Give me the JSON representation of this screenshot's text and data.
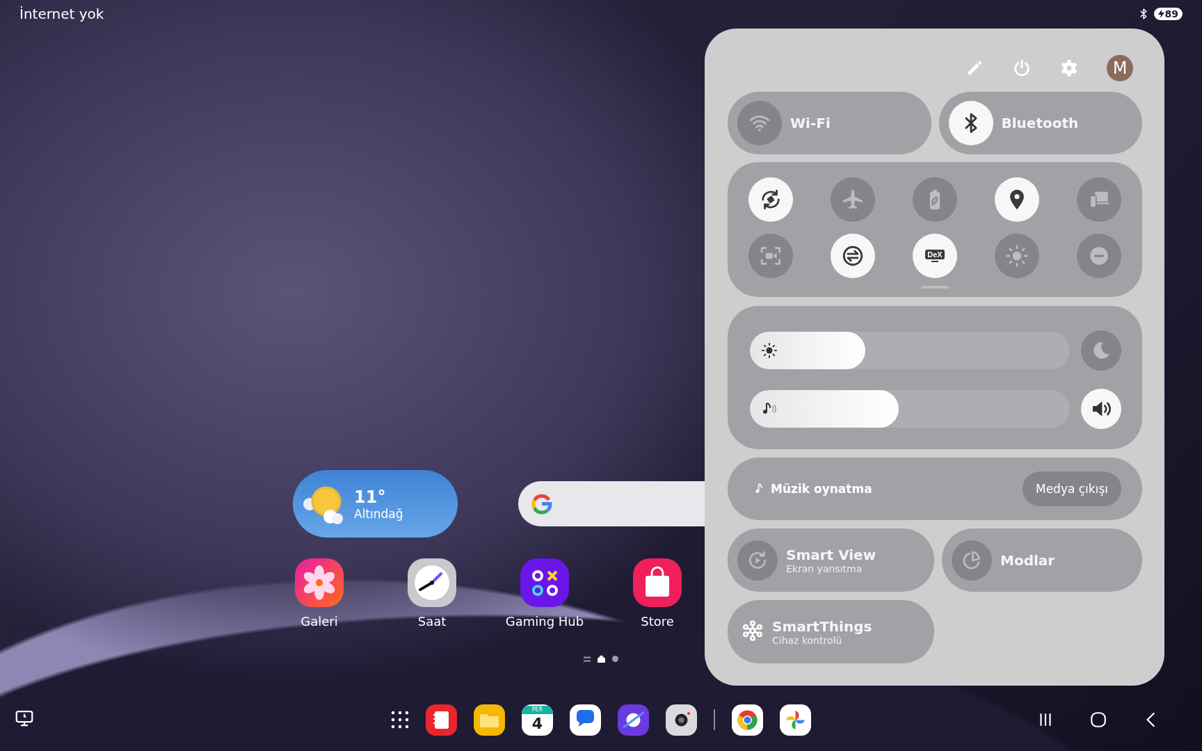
{
  "status_bar": {
    "network_text": "İnternet yok",
    "battery": "89"
  },
  "home": {
    "weather": {
      "temperature": "11°",
      "location": "Altındağ"
    },
    "apps": [
      {
        "label": "Galeri",
        "kind": "flower"
      },
      {
        "label": "Saat",
        "kind": "clock"
      },
      {
        "label": "Gaming Hub",
        "kind": "game"
      },
      {
        "label": "Store",
        "kind": "bag"
      }
    ],
    "page_indicators": [
      {
        "kind": "lines",
        "selected": false
      },
      {
        "kind": "home",
        "selected": true
      },
      {
        "kind": "dot",
        "selected": false
      }
    ]
  },
  "dock": {
    "apps": [
      {
        "kind": "grid"
      },
      {
        "kind": "notebook"
      },
      {
        "kind": "folder"
      },
      {
        "kind": "calendar",
        "month": "PER",
        "day": "4"
      },
      {
        "kind": "chat"
      },
      {
        "kind": "planet"
      },
      {
        "kind": "camera"
      },
      {
        "kind": "divider"
      },
      {
        "kind": "ring"
      },
      {
        "kind": "pinwheel"
      }
    ]
  },
  "quick_panel": {
    "avatar": "M",
    "main_tiles": [
      {
        "label": "Wi-Fi",
        "kind": "wifi",
        "on": false
      },
      {
        "label": "Bluetooth",
        "kind": "bluetooth",
        "on": true
      }
    ],
    "toggles": [
      {
        "kind": "rotate",
        "on": true
      },
      {
        "kind": "airplane",
        "on": false
      },
      {
        "kind": "battery",
        "on": false
      },
      {
        "kind": "location",
        "on": true
      },
      {
        "kind": "devices",
        "on": false
      },
      {
        "kind": "record",
        "on": false
      },
      {
        "kind": "sync",
        "on": true
      },
      {
        "kind": "dex",
        "text": "DeX",
        "on": true
      },
      {
        "kind": "sun",
        "on": false
      },
      {
        "kind": "dnd",
        "on": false
      }
    ],
    "sliders": [
      {
        "kind": "brightness",
        "level": 0.36,
        "button_on": false
      },
      {
        "kind": "volume",
        "level": 0.465,
        "button_on": true
      }
    ],
    "media": {
      "title": "Müzik oynatma",
      "button": "Medya çıkışı"
    },
    "tiles": [
      {
        "label": "Smart View",
        "sublabel": "Ekran yansıtma",
        "kind": "mirror"
      },
      {
        "label": "Modlar",
        "kind": "pie"
      },
      {
        "label": "SmartThings",
        "sublabel": "Cihaz kontrolü",
        "kind": "hub"
      }
    ]
  }
}
